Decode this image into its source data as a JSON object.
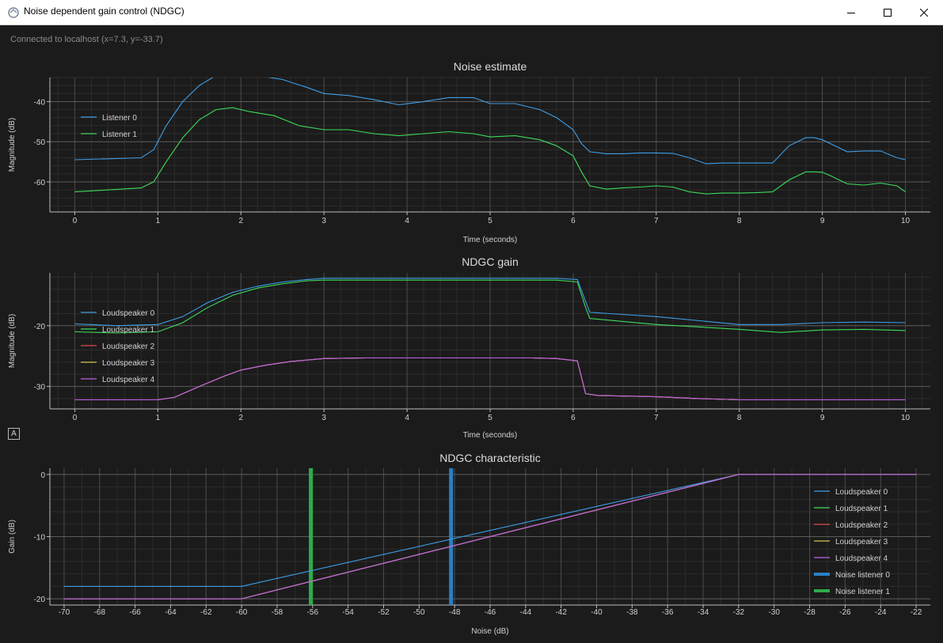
{
  "window": {
    "title": "Noise dependent gain control (NDGC)",
    "minimize_icon": "minimize-icon",
    "maximize_icon": "maximize-icon",
    "close_icon": "close-icon"
  },
  "status": "Connected to localhost (x=7.3, y=-33.7)",
  "autoscale_button": "A",
  "colors": {
    "background": "#1b1b1b",
    "grid": "#3a3a3a",
    "axis": "#bdbdbd",
    "text": "#d2d2d2",
    "blue": "#3d9ee8",
    "green": "#3ddc5a",
    "red": "#e04a4a",
    "yellow": "#d4c84a",
    "purple": "#c060ea",
    "noise_bar_blue": "#2a7fc4",
    "noise_bar_green": "#2eaa4a"
  },
  "chart_data": [
    {
      "type": "line",
      "title": "Noise estimate",
      "xlabel": "Time (seconds)",
      "ylabel": "Magnitude (dB)",
      "xlim": [
        -0.3,
        10.3
      ],
      "ylim": [
        -67.5,
        -34
      ],
      "xticks": [
        "0",
        "1",
        "2",
        "3",
        "4",
        "5",
        "6",
        "7",
        "8",
        "9",
        "10"
      ],
      "yticks": [
        "-40",
        "-50",
        "-60"
      ],
      "grid": true,
      "legend_position": "top-left",
      "series": [
        {
          "name": "Listener 0",
          "color": "#3d9ee8",
          "x": [
            0,
            0.8,
            0.95,
            1.1,
            1.3,
            1.5,
            1.7,
            1.9,
            2.2,
            2.5,
            2.8,
            3.0,
            3.3,
            3.6,
            3.9,
            4.2,
            4.5,
            4.8,
            5.0,
            5.3,
            5.6,
            5.8,
            6.0,
            6.1,
            6.2,
            6.4,
            6.6,
            6.8,
            7.0,
            7.2,
            7.4,
            7.6,
            7.8,
            8.0,
            8.2,
            8.4,
            8.6,
            8.8,
            8.9,
            9.0,
            9.1,
            9.3,
            9.5,
            9.7,
            9.9,
            10
          ],
          "y": [
            -54.5,
            -54,
            -52,
            -46,
            -40,
            -36,
            -33.5,
            -32,
            -33.5,
            -34.5,
            -36.5,
            -38,
            -38.5,
            -39.5,
            -40.8,
            -40,
            -39,
            -39,
            -40.5,
            -40.5,
            -42,
            -44,
            -47,
            -50.5,
            -52.5,
            -53,
            -53,
            -52.8,
            -52.8,
            -52.9,
            -54,
            -55.5,
            -55.3,
            -55.3,
            -55.3,
            -55.3,
            -51,
            -49,
            -49,
            -49.5,
            -50.5,
            -52.5,
            -52.3,
            -52.3,
            -54,
            -54.5
          ]
        },
        {
          "name": "Listener 1",
          "color": "#3ddc5a",
          "x": [
            0,
            0.8,
            0.95,
            1.1,
            1.3,
            1.5,
            1.7,
            1.9,
            2.1,
            2.4,
            2.7,
            3.0,
            3.3,
            3.6,
            3.9,
            4.2,
            4.5,
            4.8,
            5.0,
            5.3,
            5.6,
            5.8,
            6.0,
            6.1,
            6.2,
            6.4,
            6.6,
            6.8,
            7.0,
            7.2,
            7.4,
            7.6,
            7.8,
            8.0,
            8.2,
            8.4,
            8.6,
            8.8,
            8.9,
            9.0,
            9.1,
            9.3,
            9.5,
            9.7,
            9.9,
            10
          ],
          "y": [
            -62.5,
            -61.5,
            -60,
            -55,
            -49,
            -44.5,
            -42,
            -41.5,
            -42.5,
            -43.5,
            -46,
            -47,
            -47,
            -48,
            -48.5,
            -48,
            -47.5,
            -48,
            -48.8,
            -48.5,
            -49.5,
            -51,
            -53.5,
            -57.5,
            -61,
            -61.8,
            -61.5,
            -61.3,
            -61,
            -61.3,
            -62.5,
            -63,
            -62.8,
            -62.8,
            -62.7,
            -62.5,
            -59.5,
            -57.5,
            -57.5,
            -57.6,
            -58.5,
            -60.5,
            -60.8,
            -60.3,
            -61,
            -62.5
          ]
        }
      ]
    },
    {
      "type": "line",
      "title": "NDGC gain",
      "xlabel": "Time (seconds)",
      "ylabel": "Magnitude (dB)",
      "xlim": [
        -0.3,
        10.3
      ],
      "ylim": [
        -33.7,
        -11.3
      ],
      "xticks": [
        "0",
        "1",
        "2",
        "3",
        "4",
        "5",
        "6",
        "7",
        "8",
        "9",
        "10"
      ],
      "yticks": [
        "-20",
        "-30"
      ],
      "grid": true,
      "legend_position": "left",
      "series": [
        {
          "name": "Loudspeaker 0",
          "color": "#3d9ee8",
          "x": [
            0,
            0.5,
            1.0,
            1.3,
            1.6,
            1.9,
            2.2,
            2.5,
            2.8,
            3.0,
            3.5,
            4.0,
            4.5,
            5.0,
            5.5,
            5.8,
            6.05,
            6.15,
            6.2,
            7.0,
            8.0,
            8.5,
            9.0,
            9.5,
            10
          ],
          "y": [
            -19.7,
            -20,
            -19.8,
            -18.5,
            -16.2,
            -14.5,
            -13.5,
            -12.8,
            -12.4,
            -12.2,
            -12.2,
            -12.2,
            -12.2,
            -12.2,
            -12.2,
            -12.2,
            -12.4,
            -16,
            -17.8,
            -18.5,
            -19.8,
            -19.8,
            -19.5,
            -19.4,
            -19.5
          ]
        },
        {
          "name": "Loudspeaker 1",
          "color": "#3ddc5a",
          "x": [
            0,
            0.5,
            1.0,
            1.3,
            1.6,
            1.9,
            2.2,
            2.5,
            2.8,
            3.0,
            3.5,
            4.0,
            4.5,
            5.0,
            5.5,
            5.8,
            6.05,
            6.15,
            6.2,
            7.0,
            8.0,
            8.5,
            9.0,
            9.5,
            10
          ],
          "y": [
            -21,
            -21.2,
            -21,
            -19.5,
            -17,
            -15,
            -13.8,
            -13.1,
            -12.6,
            -12.5,
            -12.5,
            -12.5,
            -12.5,
            -12.5,
            -12.5,
            -12.5,
            -12.8,
            -17,
            -18.8,
            -19.8,
            -20.6,
            -21.1,
            -20.7,
            -20.6,
            -20.8
          ]
        },
        {
          "name": "Loudspeaker 2",
          "color": "#e04a4a",
          "x": [
            0,
            0.5,
            1.0,
            1.2,
            1.5,
            1.8,
            2.0,
            2.3,
            2.6,
            3.0,
            3.5,
            4.0,
            4.5,
            5.0,
            5.5,
            5.8,
            6.05,
            6.15,
            6.3,
            7.0,
            7.5,
            8.0,
            8.5,
            9.0,
            9.5,
            10
          ],
          "y": [
            -32.2,
            -32.2,
            -32.2,
            -31.8,
            -30,
            -28.3,
            -27.3,
            -26.5,
            -25.9,
            -25.4,
            -25.3,
            -25.3,
            -25.3,
            -25.3,
            -25.3,
            -25.4,
            -25.8,
            -31.2,
            -31.5,
            -31.7,
            -32,
            -32.2,
            -32.2,
            -32.2,
            -32.2,
            -32.2
          ]
        },
        {
          "name": "Loudspeaker 3",
          "color": "#d4c84a",
          "x": [
            0,
            0.5,
            1.0,
            1.2,
            1.5,
            1.8,
            2.0,
            2.3,
            2.6,
            3.0,
            3.5,
            4.0,
            4.5,
            5.0,
            5.5,
            5.8,
            6.05,
            6.15,
            6.3,
            7.0,
            7.5,
            8.0,
            8.5,
            9.0,
            9.5,
            10
          ],
          "y": [
            -32.2,
            -32.2,
            -32.2,
            -31.8,
            -30,
            -28.3,
            -27.3,
            -26.5,
            -25.9,
            -25.4,
            -25.3,
            -25.3,
            -25.3,
            -25.3,
            -25.3,
            -25.4,
            -25.8,
            -31.2,
            -31.5,
            -31.7,
            -32,
            -32.2,
            -32.2,
            -32.2,
            -32.2,
            -32.2
          ]
        },
        {
          "name": "Loudspeaker 4",
          "color": "#c060ea",
          "x": [
            0,
            0.5,
            1.0,
            1.2,
            1.5,
            1.8,
            2.0,
            2.3,
            2.6,
            3.0,
            3.5,
            4.0,
            4.5,
            5.0,
            5.5,
            5.8,
            6.05,
            6.15,
            6.3,
            7.0,
            7.5,
            8.0,
            8.5,
            9.0,
            9.5,
            10
          ],
          "y": [
            -32.2,
            -32.2,
            -32.2,
            -31.8,
            -30,
            -28.3,
            -27.3,
            -26.5,
            -25.9,
            -25.4,
            -25.3,
            -25.3,
            -25.3,
            -25.3,
            -25.3,
            -25.4,
            -25.8,
            -31.2,
            -31.5,
            -31.7,
            -32,
            -32.2,
            -32.2,
            -32.2,
            -32.2,
            -32.2
          ]
        }
      ]
    },
    {
      "type": "line",
      "title": "NDGC characteristic",
      "xlabel": "Noise (dB)",
      "ylabel": "Gain (dB)",
      "xlim": [
        -70.8,
        -21.2
      ],
      "ylim": [
        -21,
        1
      ],
      "xticks": [
        "-70",
        "-68",
        "-66",
        "-64",
        "-62",
        "-60",
        "-58",
        "-56",
        "-54",
        "-52",
        "-50",
        "-48",
        "-46",
        "-44",
        "-42",
        "-40",
        "-38",
        "-36",
        "-34",
        "-32",
        "-30",
        "-28",
        "-26",
        "-24",
        "-22"
      ],
      "yticks": [
        "0",
        "-10",
        "-20"
      ],
      "grid": true,
      "legend_position": "right",
      "series": [
        {
          "name": "Loudspeaker 0",
          "color": "#3d9ee8",
          "x": [
            -70,
            -60,
            -32,
            -22
          ],
          "y": [
            -18,
            -18,
            0,
            0
          ]
        },
        {
          "name": "Loudspeaker 1",
          "color": "#3ddc5a",
          "x": [
            -70,
            -60,
            -32,
            -22
          ],
          "y": [
            -20,
            -20,
            0,
            0
          ]
        },
        {
          "name": "Loudspeaker 2",
          "color": "#e04a4a",
          "x": [
            -70,
            -60,
            -32,
            -22
          ],
          "y": [
            -20,
            -20,
            0,
            0
          ]
        },
        {
          "name": "Loudspeaker 3",
          "color": "#d4c84a",
          "x": [
            -70,
            -60,
            -32,
            -22
          ],
          "y": [
            -20,
            -20,
            0,
            0
          ]
        },
        {
          "name": "Loudspeaker 4",
          "color": "#c060ea",
          "x": [
            -70,
            -60,
            -32,
            -22
          ],
          "y": [
            -20,
            -20,
            0,
            0
          ]
        }
      ],
      "markers": [
        {
          "name": "Noise listener 0",
          "color": "#2a7fc4",
          "x": -48.2
        },
        {
          "name": "Noise listener 1",
          "color": "#2eaa4a",
          "x": -56.1
        }
      ]
    }
  ]
}
